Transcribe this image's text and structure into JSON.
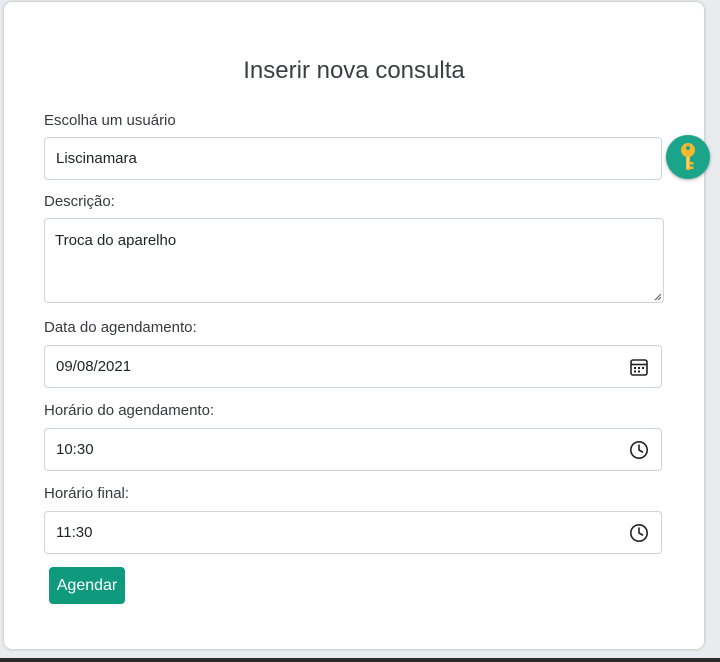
{
  "form": {
    "title": "Inserir nova consulta",
    "user_label": "Escolha um usuário",
    "user_value": "Liscinamara",
    "description_label": "Descrição:",
    "description_value": "Troca do aparelho",
    "date_label": "Data do agendamento:",
    "date_value": "09/08/2021",
    "time_label": "Horário do agendamento:",
    "time_value": "10:30",
    "end_time_label": "Horário final:",
    "end_time_value": "11:30",
    "submit_label": "Agendar"
  },
  "icons": {
    "date_field": "calendar-icon",
    "time_field": "clock-icon",
    "floating_button": "key-icon"
  },
  "colors": {
    "accent": "#0f9a7d",
    "fab": "#1aa58a",
    "key": "#f5b82e"
  }
}
